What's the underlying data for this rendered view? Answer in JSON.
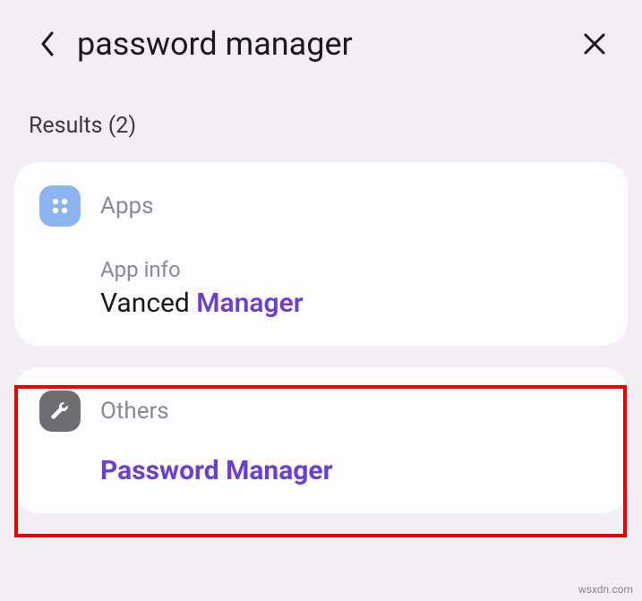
{
  "header": {
    "search_query": "password manager"
  },
  "results": {
    "label": "Results (2)"
  },
  "sections": {
    "apps": {
      "label": "Apps",
      "item_sub": "App info",
      "item_prefix": "Vanced ",
      "item_highlight": "Manager"
    },
    "others": {
      "label": "Others",
      "item_title": "Password Manager"
    }
  },
  "watermark": "wsxdn.com"
}
